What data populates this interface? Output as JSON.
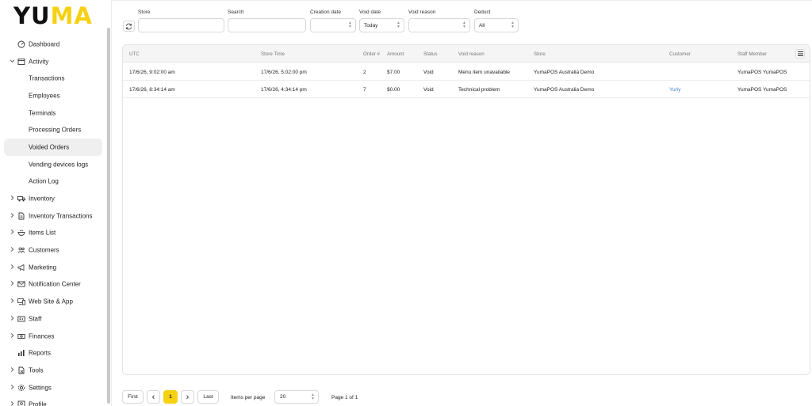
{
  "logo": {
    "part1": "YU",
    "part2": "MA"
  },
  "colors": {
    "accent": "#f5d112",
    "link": "#3c7fd6"
  },
  "sidebar": {
    "items": [
      {
        "label": "Dashboard",
        "icon": "dashboard-icon",
        "expandable": false,
        "sub": false,
        "active": false
      },
      {
        "label": "Activity",
        "icon": "calendar-icon",
        "expandable": true,
        "expanded": true,
        "sub": false,
        "active": false
      },
      {
        "label": "Transactions",
        "sub": true,
        "active": false
      },
      {
        "label": "Employees",
        "sub": true,
        "active": false
      },
      {
        "label": "Terminals",
        "sub": true,
        "active": false
      },
      {
        "label": "Processing Orders",
        "sub": true,
        "active": false
      },
      {
        "label": "Voided Orders",
        "sub": true,
        "active": true
      },
      {
        "label": "Vending devices logs",
        "sub": true,
        "active": false
      },
      {
        "label": "Action Log",
        "sub": true,
        "active": false
      },
      {
        "label": "Inventory",
        "icon": "truck-icon",
        "expandable": true,
        "sub": false
      },
      {
        "label": "Inventory Transactions",
        "icon": "document-icon",
        "expandable": true,
        "sub": false
      },
      {
        "label": "Items List",
        "icon": "bowl-icon",
        "expandable": true,
        "sub": false
      },
      {
        "label": "Customers",
        "icon": "users-icon",
        "expandable": true,
        "sub": false
      },
      {
        "label": "Marketing",
        "icon": "megaphone-icon",
        "expandable": true,
        "sub": false
      },
      {
        "label": "Notification Center",
        "icon": "mail-icon",
        "expandable": true,
        "sub": false
      },
      {
        "label": "Web Site & App",
        "icon": "devices-icon",
        "expandable": true,
        "sub": false
      },
      {
        "label": "Staff",
        "icon": "id-card-icon",
        "expandable": true,
        "sub": false
      },
      {
        "label": "Finances",
        "icon": "cash-icon",
        "expandable": true,
        "sub": false
      },
      {
        "label": "Reports",
        "icon": "bar-chart-icon",
        "expandable": false,
        "sub": false
      },
      {
        "label": "Tools",
        "icon": "tools-icon",
        "expandable": true,
        "sub": false
      },
      {
        "label": "Settings",
        "icon": "gear-icon",
        "expandable": true,
        "sub": false
      },
      {
        "label": "Profile",
        "icon": "profile-icon",
        "expandable": true,
        "sub": false
      }
    ]
  },
  "filters": {
    "store_label": "Store",
    "store_value": "",
    "search_label": "Search",
    "search_value": "",
    "creation_label": "Creation date",
    "creation_value": "",
    "void_date_label": "Void date",
    "void_date_value": "Today",
    "void_reason_label": "Void reason",
    "void_reason_value": "",
    "deduct_label": "Deduct",
    "deduct_value": "All"
  },
  "table": {
    "headers": [
      "UTC",
      "Store Time",
      "Order #",
      "Amount",
      "Status",
      "Void reason",
      "Store",
      "Customer",
      "Staff Member"
    ],
    "rows": [
      [
        "17/6/26, 9:02:00 am",
        "17/6/26, 5:02:00 pm",
        "2",
        "$7.00",
        "Void",
        "Menu item unavailable",
        "YumaPOS Australia Demo",
        "",
        "YumaPOS YumaPOS"
      ],
      [
        "17/6/26, 8:34:14 am",
        "17/6/26, 4:34:14 pm",
        "7",
        "$0.00",
        "Void",
        "Technical problem",
        "YumaPOS Australia Demo",
        "Yuriy",
        "YumaPOS YumaPOS"
      ]
    ]
  },
  "pager": {
    "first": "First",
    "prev": "‹",
    "current": "1",
    "next": "›",
    "last": "Last",
    "per_page_label": "Items per page",
    "per_page_value": "20",
    "page_info": "Page 1 of 1"
  }
}
